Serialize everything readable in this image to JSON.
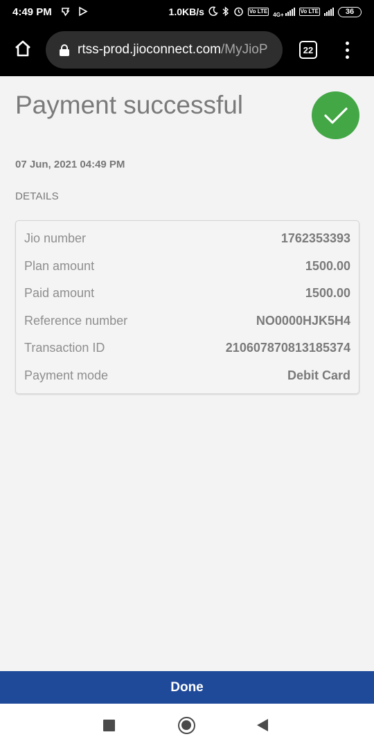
{
  "status_bar": {
    "time": "4:49 PM",
    "network_speed": "1.0KB/s",
    "network_type": "4G+",
    "volte_label": "Vo LTE",
    "battery": "36",
    "icons": [
      "download-icon",
      "play-store-icon",
      "moon-icon",
      "bluetooth-icon",
      "alarm-icon",
      "signal-icon",
      "battery-icon"
    ]
  },
  "browser": {
    "url_domain": "rtss-prod.jioconnect.com",
    "url_path": "/MyJioP",
    "tab_count": "22",
    "icons": [
      "home-icon",
      "lock-icon",
      "tabs-icon",
      "more-menu-icon"
    ]
  },
  "page": {
    "title": "Payment successful",
    "date": "07 Jun, 2021 04:49 PM",
    "details_heading": "DETAILS",
    "accent_color": "#43a746",
    "details": [
      {
        "label": "Jio number",
        "value": "1762353393"
      },
      {
        "label": "Plan amount",
        "value": "1500.00"
      },
      {
        "label": "Paid amount",
        "value": "1500.00"
      },
      {
        "label": "Reference number",
        "value": "NO0000HJK5H4"
      },
      {
        "label": "Transaction ID",
        "value": "210607870813185374"
      },
      {
        "label": "Payment mode",
        "value": "Debit Card"
      }
    ]
  },
  "footer": {
    "done_label": "Done",
    "button_color": "#1f4a9a"
  },
  "nav_bar": {
    "icons": [
      "recent-apps-icon",
      "home-circle-icon",
      "back-icon"
    ]
  }
}
